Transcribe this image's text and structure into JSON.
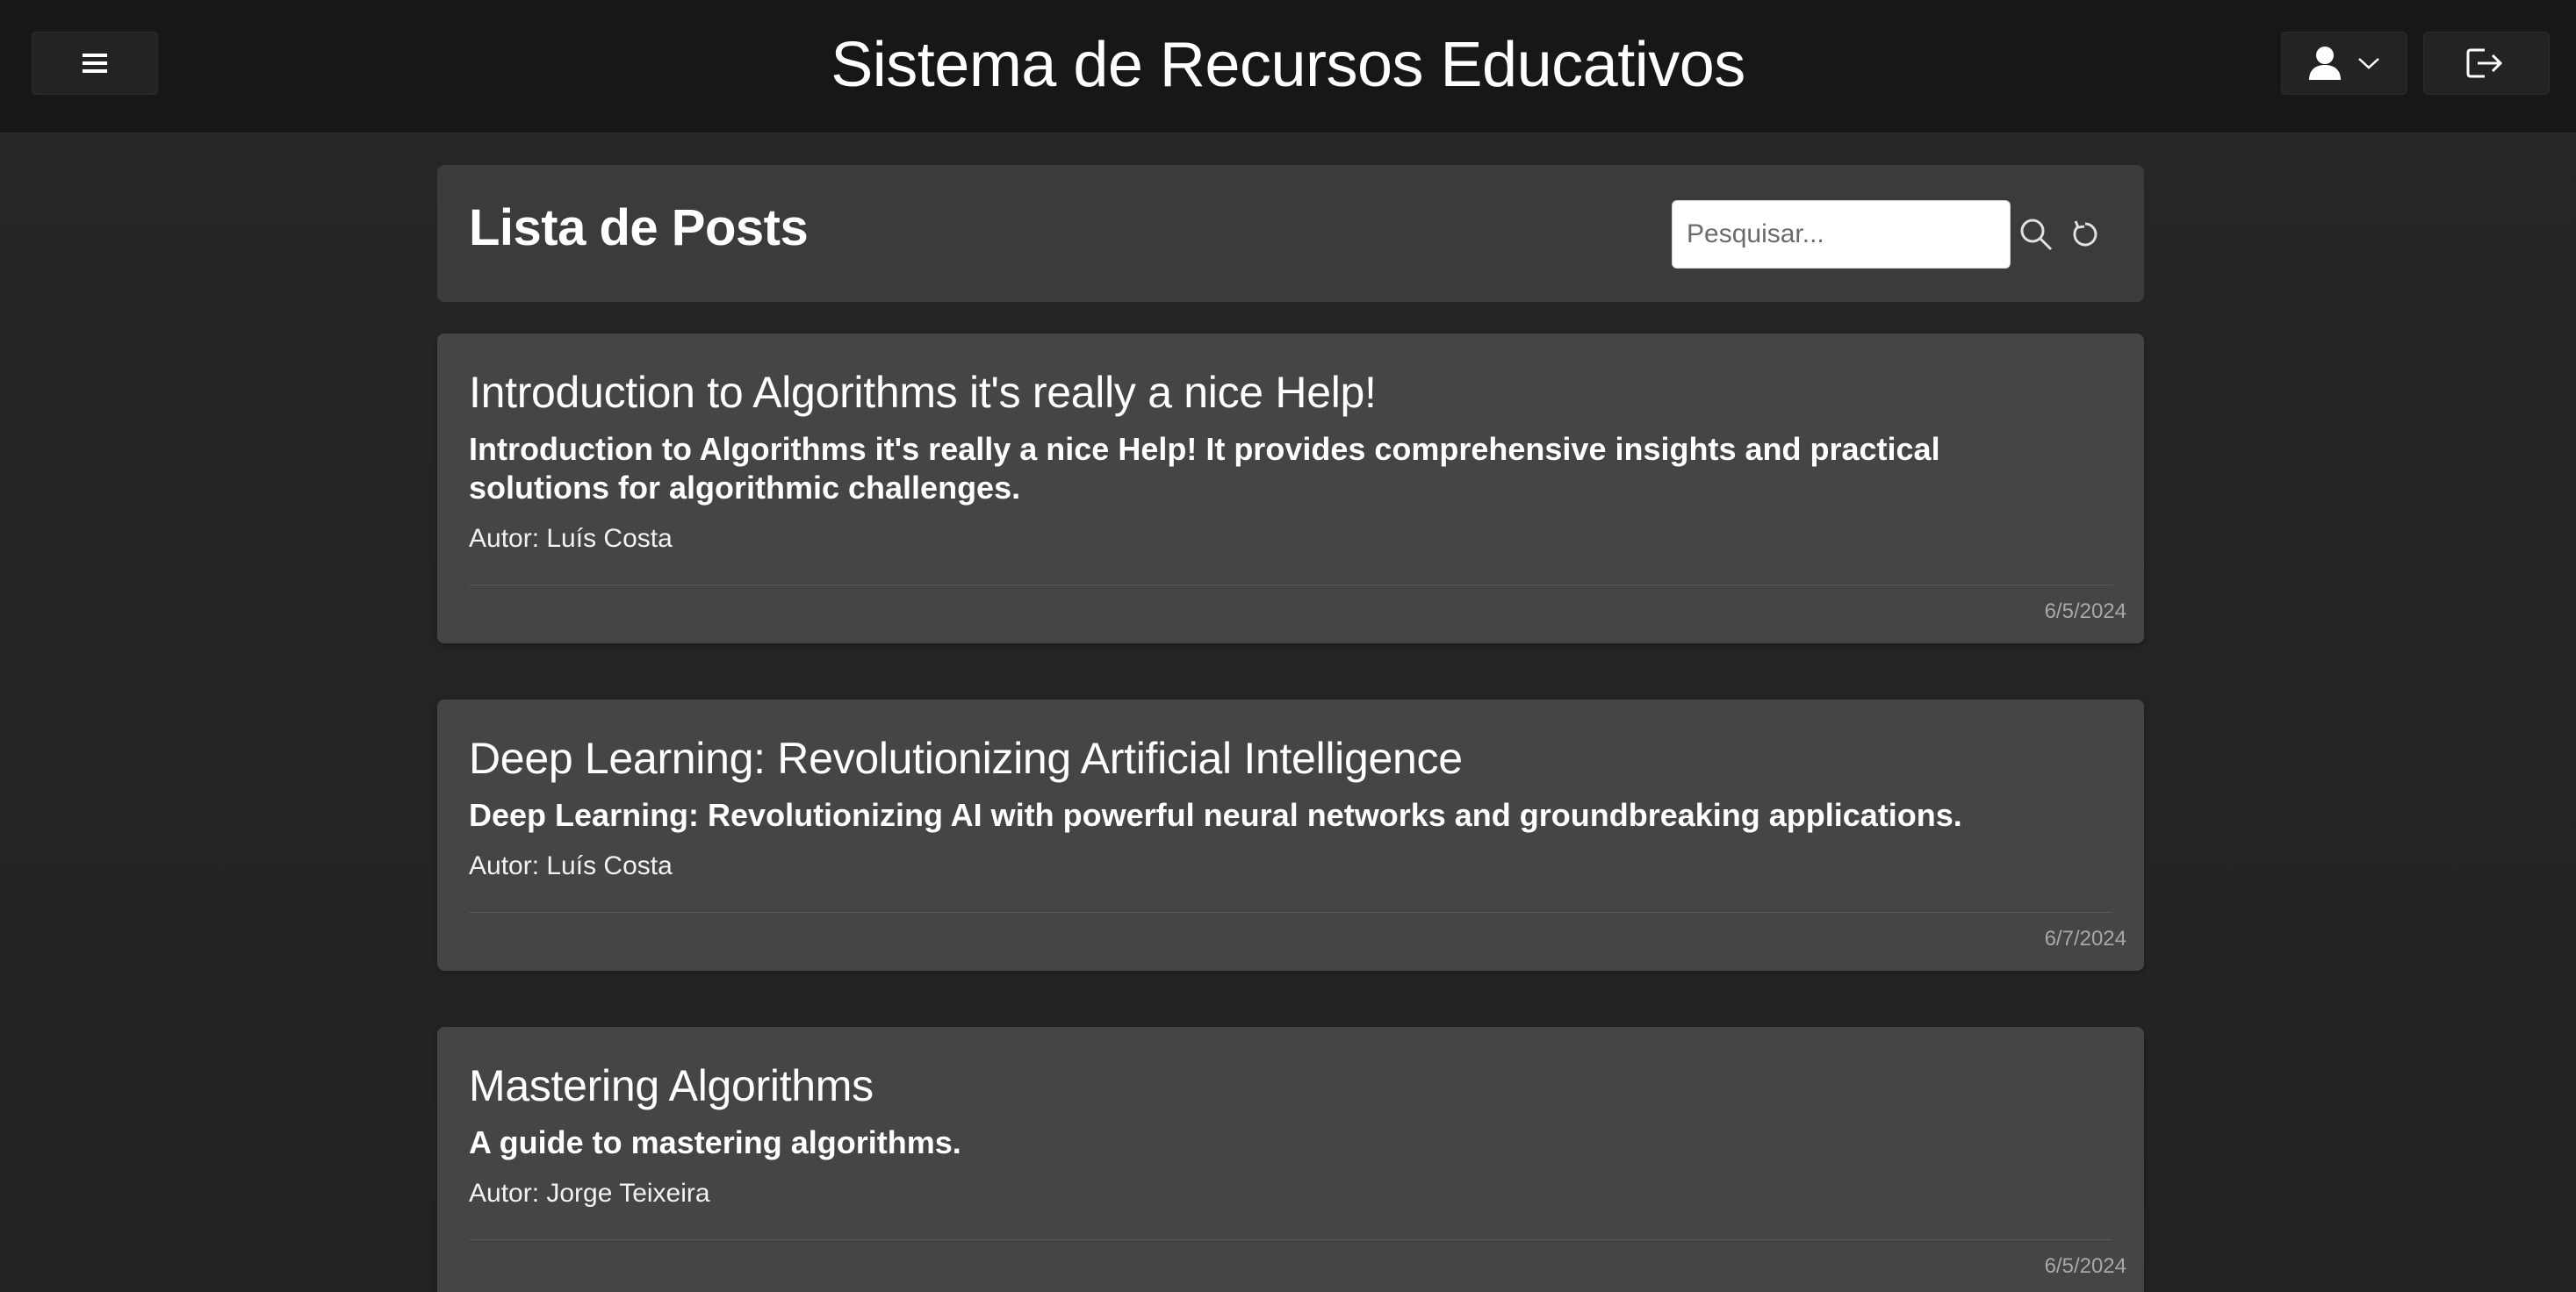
{
  "header": {
    "title": "Sistema de Recursos Educativos",
    "menu_icon": "hamburger-menu-icon",
    "user_icon": "user-icon",
    "logout_icon": "logout-icon"
  },
  "toolbar": {
    "title": "Lista de Posts",
    "search_placeholder": "Pesquisar...",
    "search_value": ""
  },
  "posts": [
    {
      "title": "Introduction to Algorithms it's really a nice Help!",
      "description": "Introduction to Algorithms it's really a nice Help! It provides comprehensive insights and practical solutions for algorithmic challenges.",
      "author": "Autor: Luís Costa",
      "date": "6/5/2024"
    },
    {
      "title": "Deep Learning: Revolutionizing Artificial Intelligence",
      "description": "Deep Learning: Revolutionizing AI with powerful neural networks and groundbreaking applications.",
      "author": "Autor: Luís Costa",
      "date": "6/7/2024"
    },
    {
      "title": "Mastering Algorithms",
      "description": "A guide to mastering algorithms.",
      "author": "Autor: Jorge Teixeira",
      "date": "6/5/2024"
    }
  ],
  "colors": {
    "background": "#242424",
    "header": "#171717",
    "toolbar": "#3b3b3b",
    "card": "#454545",
    "text": "#ffffff",
    "muted": "#a8a8a8"
  }
}
